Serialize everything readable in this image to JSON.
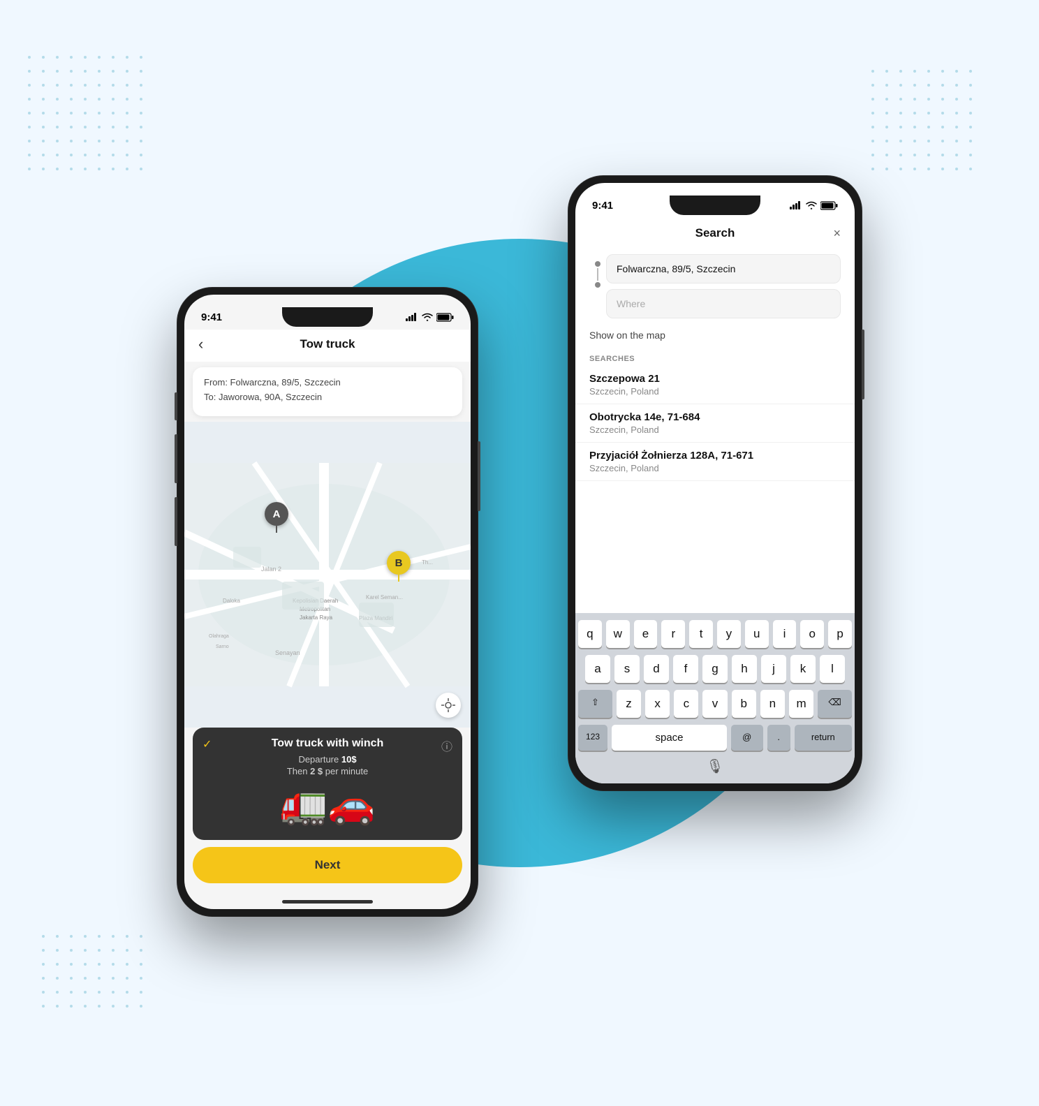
{
  "background": {
    "circle_color": "#3bb8d8"
  },
  "phone_back": {
    "status_bar": {
      "time": "9:41"
    },
    "header": {
      "title": "Search",
      "close_label": "×"
    },
    "from_field": {
      "value": "Folwarczna, 89/5, Szczecin"
    },
    "to_field": {
      "placeholder": "Where"
    },
    "show_map": "Show on the map",
    "searches_label": "SEARCHES",
    "results": [
      {
        "name": "Szczepowa 21",
        "sub": "Szczecin, Poland"
      },
      {
        "name": "Obotrycka 14e, 71-684",
        "sub": "Szczecin, Poland"
      },
      {
        "name": "Przyjaciół Żołnierza 128A, 71-671",
        "sub": "Szczecin, Poland"
      }
    ],
    "keyboard": {
      "row1": [
        "q",
        "w",
        "e",
        "r",
        "t",
        "y",
        "u",
        "i",
        "o",
        "p"
      ],
      "row2": [
        "a",
        "s",
        "d",
        "f",
        "g",
        "h",
        "j",
        "k",
        "l"
      ],
      "row3": [
        "z",
        "x",
        "c",
        "v",
        "b",
        "n",
        "m"
      ],
      "bottom": [
        "space",
        "@",
        ".",
        "return"
      ],
      "space_label": "space",
      "at_label": "@",
      "dot_label": ".",
      "return_label": "return"
    }
  },
  "phone_front": {
    "status_bar": {
      "time": "9:41"
    },
    "header": {
      "title": "Tow truck",
      "back_label": "‹"
    },
    "route": {
      "from": "From: Folwarczna, 89/5, Szczecin",
      "to": "To: Jaworowa, 90A, Szczecin"
    },
    "map": {
      "marker_a": "A",
      "marker_b": "B"
    },
    "service": {
      "name": "Tow truck with winch",
      "departure": "Departure ",
      "departure_price": "10$",
      "then": "Then ",
      "per_minute_price": "2 $",
      "per_minute_label": " per minute",
      "emoji": "🚛🚗"
    },
    "next_btn": "Next"
  }
}
